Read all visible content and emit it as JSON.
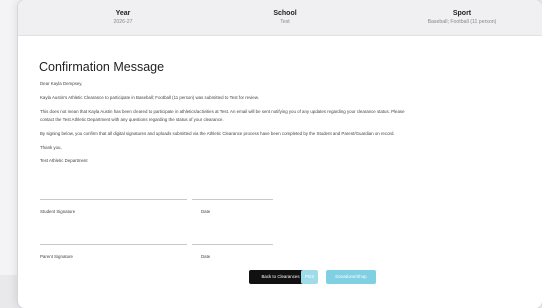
{
  "summary": {
    "year": {
      "label": "Year",
      "value": "2026-27"
    },
    "school": {
      "label": "School",
      "value": "Test"
    },
    "sport": {
      "label": "Sport",
      "value": "Baseball; Football (11 person)"
    }
  },
  "confirmation": {
    "title": "Confirmation Message",
    "greeting": "Dear Kayla Dempsey,",
    "p1": "Kayla Austin's Athletic Clearance to participate in Baseball; Football (11 person) was submitted to Test for review.",
    "p2a": "This does not mean that Kayla Austin has been cleared to participate in athletics/activities at Test. An email will be sent notifying you of any updates regarding your clearance status. Please",
    "p2b": "contact the Test Athletic Department with any questions regarding the status of your clearance.",
    "p3": "By signing below, you confirm that all digital signatures and uploads submitted via the Athletic Clearance process have been completed by the Student and Parent/Guardian on record.",
    "thanks": "Thank you,",
    "dept": "Test Athletic Department"
  },
  "signatures": {
    "student_label": "Student Signature",
    "student_date": "Date",
    "parent_label": "Parent Signature",
    "parent_date": "Date"
  },
  "buttons": {
    "back": "Back to Clearances",
    "print": "Print",
    "donations": "Donations/Shop"
  }
}
